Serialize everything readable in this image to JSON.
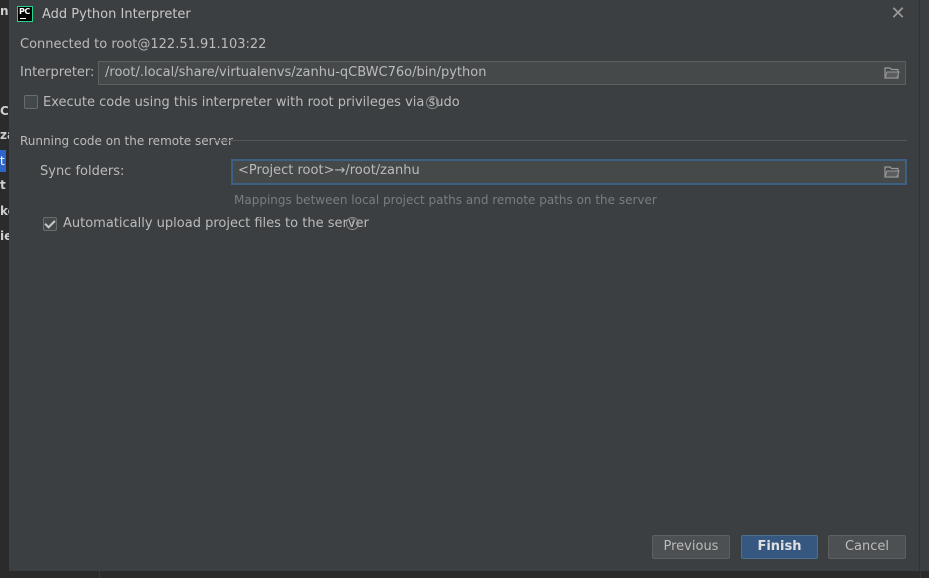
{
  "window": {
    "title": "Add Python Interpreter",
    "app_icon_label": "PC"
  },
  "background_letters": [
    "n",
    "C",
    "za",
    "t",
    "t",
    "ke",
    "ie"
  ],
  "connection": {
    "text": "Connected to root@122.51.91.103:22"
  },
  "interpreter": {
    "label": "Interpreter:",
    "value": "/root/.local/share/virtualenvs/zanhu-qCBWC76o/bin/python"
  },
  "sudo": {
    "label": "Execute code using this interpreter with root privileges via sudo",
    "checked": false
  },
  "section": {
    "title": "Running code on the remote server"
  },
  "sync": {
    "label": "Sync folders:",
    "value": "<Project root>→/root/zanhu",
    "hint": "Mappings between local project paths and remote paths on the server"
  },
  "auto_upload": {
    "label": "Automatically upload project files to the server",
    "checked": true
  },
  "buttons": {
    "previous": "Previous",
    "finish": "Finish",
    "cancel": "Cancel"
  },
  "colors": {
    "background": "#3c3f41",
    "primary_button": "#365880",
    "focus_border": "#3d6185"
  }
}
